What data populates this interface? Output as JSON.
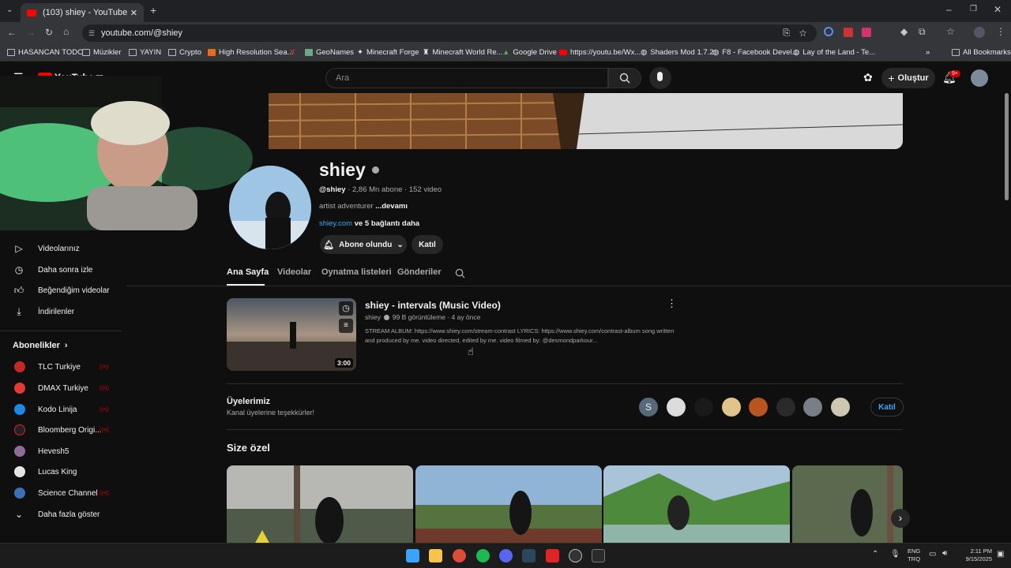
{
  "browser": {
    "tab_title": "(103) shiey - YouTube",
    "url": "youtube.com/@shiey",
    "bookmarks": [
      "HASANCAN TODO",
      "Müzikler",
      "YAYIN",
      "Crypto",
      "High Resolution Sea...",
      "GeoNames",
      "Minecraft Forge",
      "Minecraft World Re...",
      "Google Drive",
      "https://youtu.be/Wx...",
      "Shaders Mod 1.7.2",
      "F8 - Facebook Devel...",
      "Lay of the Land - Te..."
    ],
    "all_bookmarks": "All Bookmarks"
  },
  "header": {
    "logo": "YouTube",
    "logo_region": "TR",
    "search_placeholder": "Ara",
    "create_label": "Oluştur",
    "notif_count": "9+"
  },
  "sidebar": {
    "items": [
      {
        "label": "Videolarınız",
        "icon": "play-square-icon"
      },
      {
        "label": "Daha sonra izle",
        "icon": "clock-icon"
      },
      {
        "label": "Beğendiğim videolar",
        "icon": "thumbs-up-icon"
      },
      {
        "label": "İndirilenler",
        "icon": "download-icon"
      }
    ],
    "subs_title": "Abonelikler",
    "subs": [
      {
        "label": "TLC Turkiye",
        "color": "#c62828"
      },
      {
        "label": "DMAX Turkiye",
        "color": "#e53935"
      },
      {
        "label": "Kodo Linija",
        "color": "#1e88e5"
      },
      {
        "label": "Bloomberg Origi...",
        "color": "#222222"
      },
      {
        "label": "Hevesh5",
        "color": "#8e6e99"
      },
      {
        "label": "Lucas King",
        "color": "#e6e6e6"
      },
      {
        "label": "Science Channel",
        "color": "#3d6fb6"
      }
    ],
    "show_more": "Daha fazla göster"
  },
  "channel": {
    "name": "shiey",
    "handle": "@shiey",
    "stats": " · 2,86 Mn abone · 152 video",
    "desc": "artist adventurer ",
    "more": "...devamı",
    "link": "shiey.com",
    "links_more": " ve 5 bağlantı daha",
    "subscribed": "Abone olundu",
    "join": "Katıl",
    "tabs": [
      "Ana Sayfa",
      "Videolar",
      "Oynatma listeleri",
      "Gönderiler"
    ]
  },
  "featured": {
    "title": "shiey - intervals (Music Video)",
    "channel": "shiey",
    "meta": "99 B görüntüleme · 4 ay önce",
    "description": "STREAM ALBUM: https://www.shiey.com/stream-contrast LYRICS: https://www.shiey.com/contrast-album song written and produced by me. video directed, edited by me. video filmed by: @desmondparkour...",
    "duration": "3:00"
  },
  "members": {
    "title": "Üyelerimiz",
    "subtitle": "Kanal üyelerine teşekkürler!",
    "first_initial": "S",
    "join": "Katıl"
  },
  "for_you": {
    "title": "Size özel"
  },
  "taskbar": {
    "lang1": "ENG",
    "lang2": "TRQ",
    "time": "2:11 PM",
    "date": "9/15/2025"
  }
}
